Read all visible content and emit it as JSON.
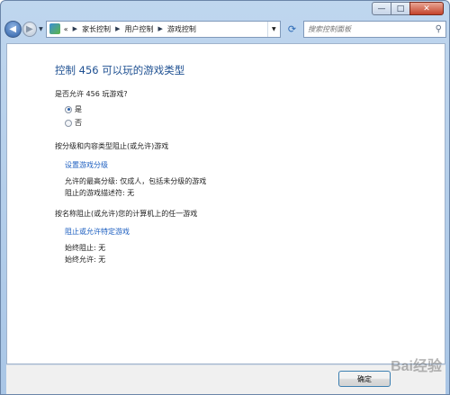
{
  "window": {
    "caption_buttons": {
      "min": "—",
      "max": "□",
      "close": "✕"
    }
  },
  "navbar": {
    "back_icon": "back-arrow-icon",
    "forward_icon": "forward-arrow-icon",
    "crumb_prefix": "«",
    "breadcrumbs": [
      "家长控制",
      "用户控制",
      "游戏控制"
    ],
    "search_placeholder": "搜索控制面板"
  },
  "main": {
    "title": "控制 456 可以玩的游戏类型",
    "allow_question": "是否允许 456 玩游戏?",
    "options": [
      {
        "label": "是",
        "checked": true
      },
      {
        "label": "否",
        "checked": false
      }
    ],
    "section1_heading": "按分级和内容类型阻止(或允许)游戏",
    "section1_link": "设置游戏分级",
    "section1_info1": "允许的最高分级: 仅成人，包括未分级的游戏",
    "section1_info2": "阻止的游戏描述符: 无",
    "section2_heading": "按名称阻止(或允许)您的计算机上的任一游戏",
    "section2_link": "阻止或允许特定游戏",
    "section2_info1": "始终阻止: 无",
    "section2_info2": "始终允许: 无"
  },
  "footer": {
    "ok_label": "确定"
  },
  "watermark": "Bai经验"
}
